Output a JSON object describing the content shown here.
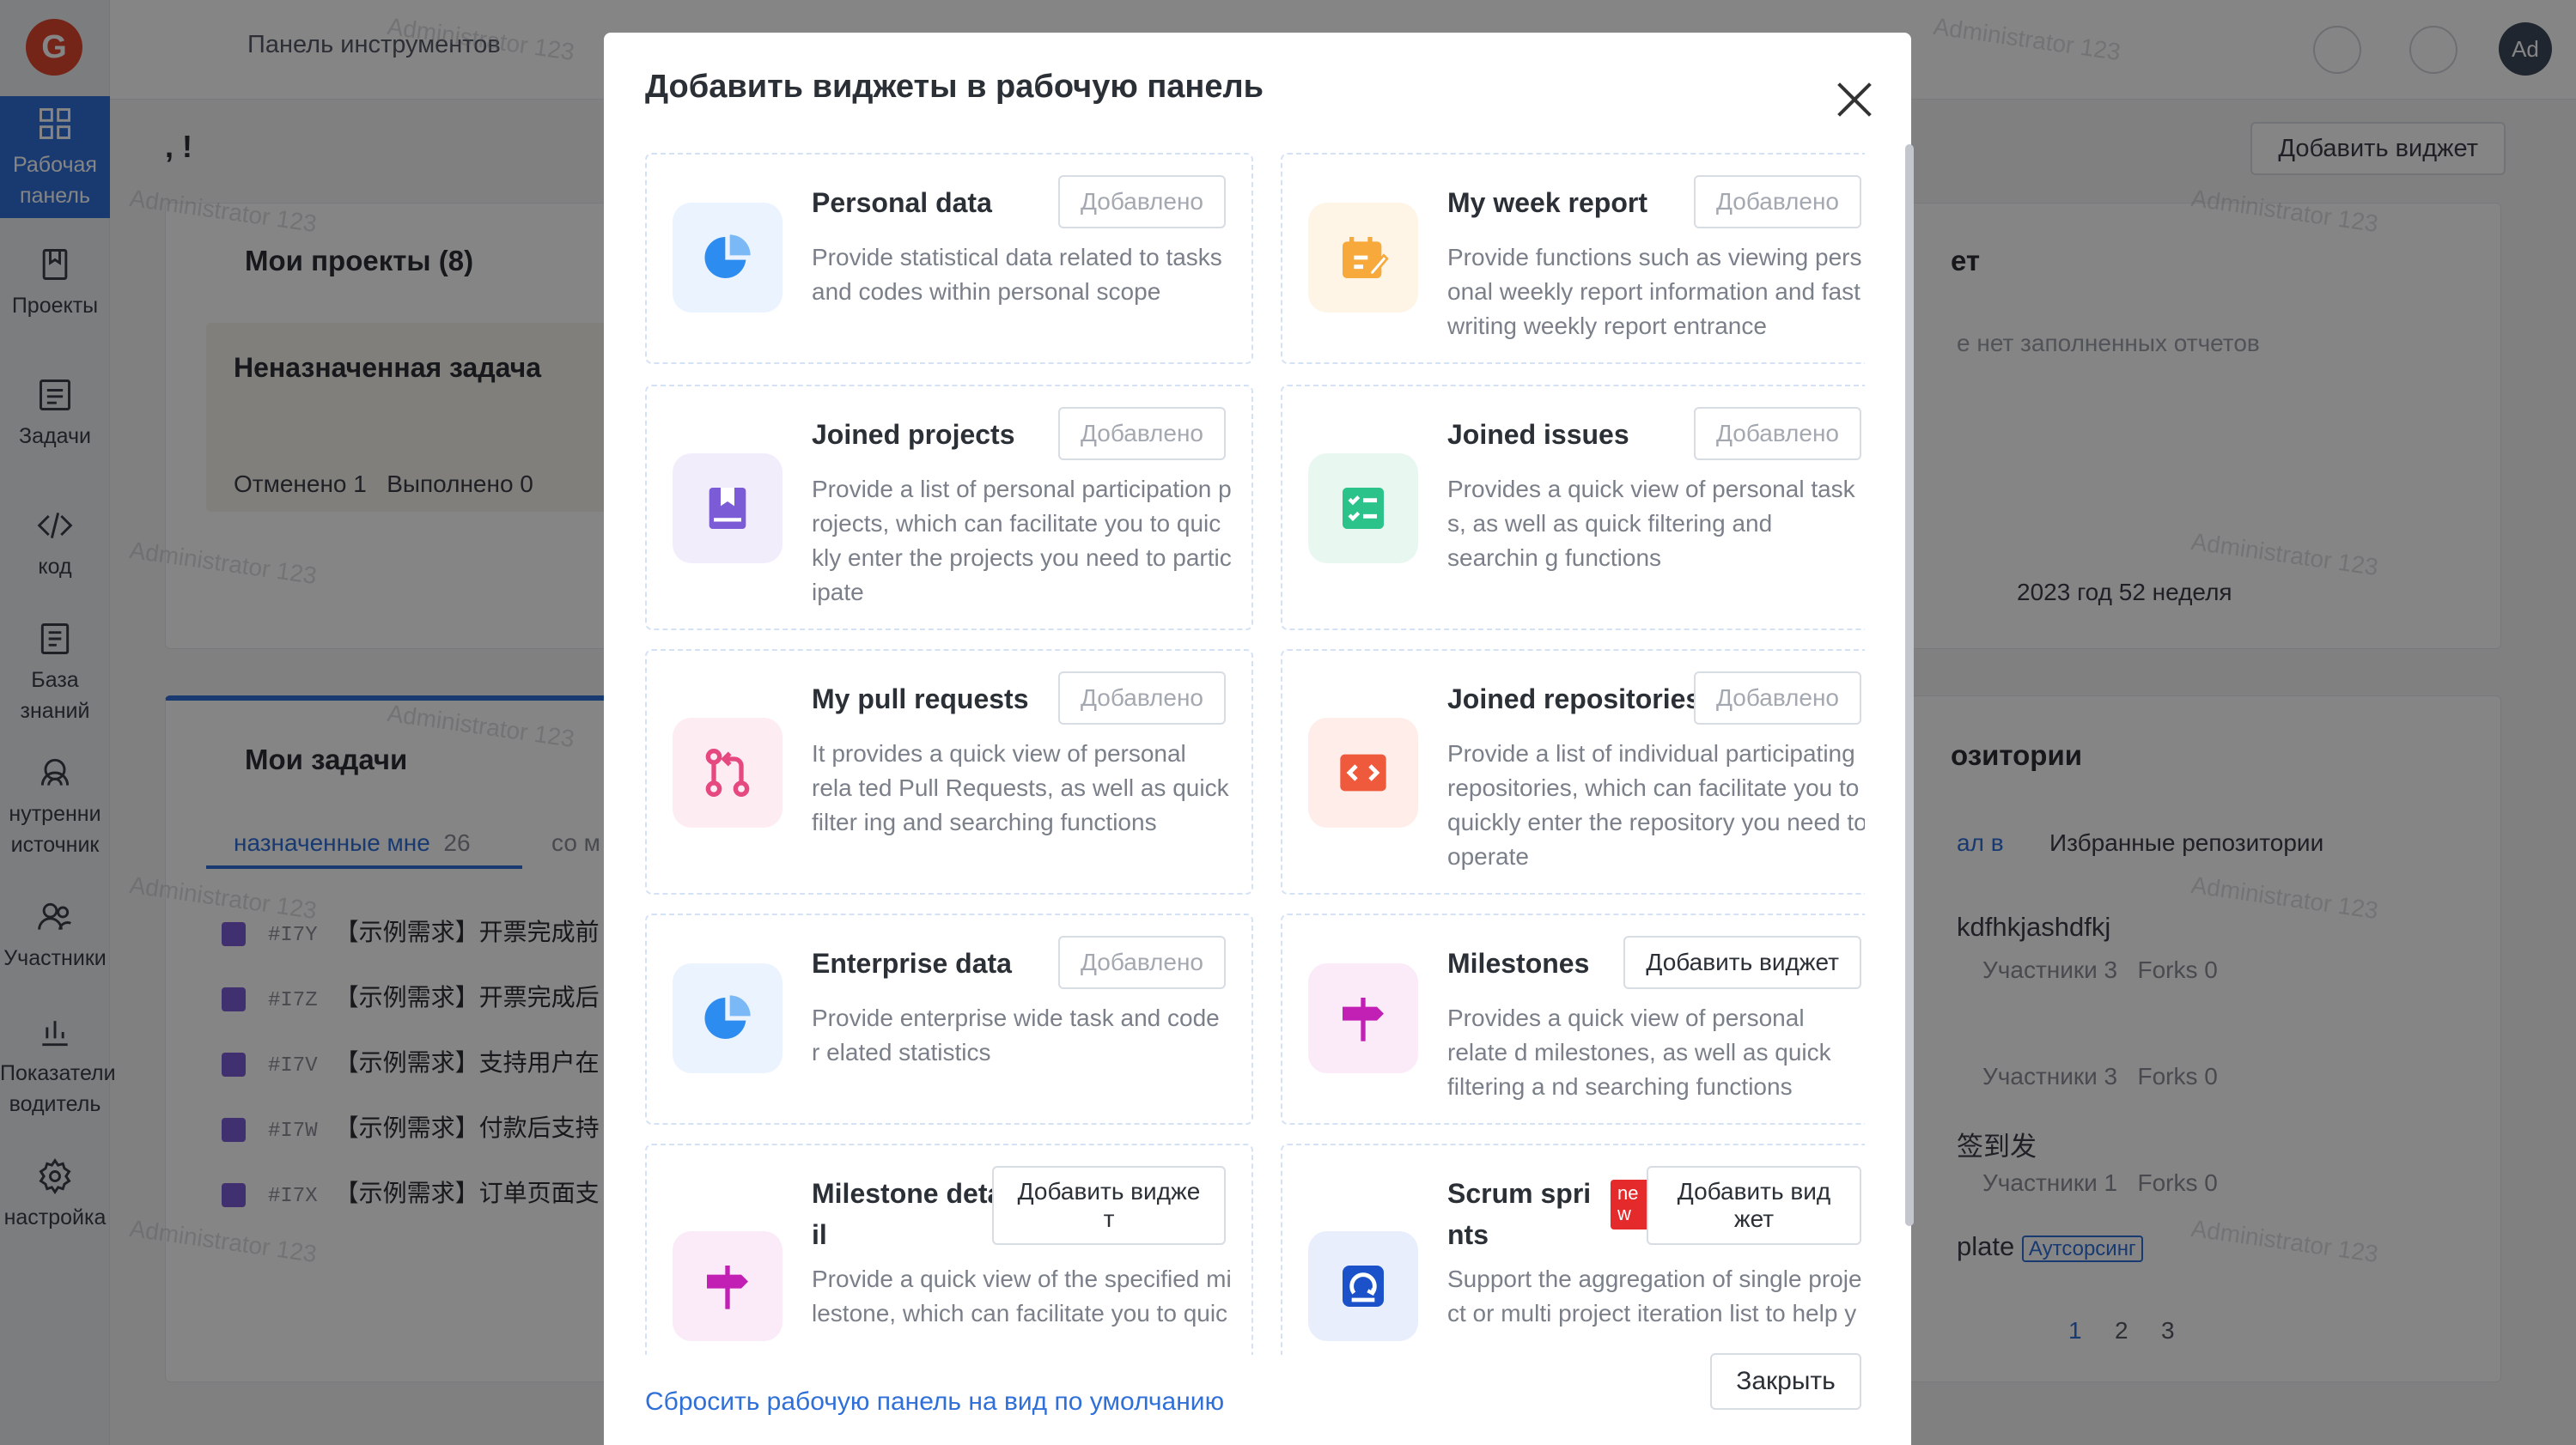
{
  "app": {
    "logo": "G",
    "breadcrumb": "Панель инструментов",
    "avatar": "Ad",
    "greeting": ", !",
    "add_widget_label": "Добавить виджет",
    "sidebar": [
      {
        "label": "Рабочая панель",
        "icon": "dashboard-icon",
        "active": true
      },
      {
        "label": "Проекты",
        "icon": "projects-icon"
      },
      {
        "label": "Задачи",
        "icon": "tasks-icon"
      },
      {
        "label": "код",
        "icon": "code-icon"
      },
      {
        "label": "База знаний",
        "icon": "knowledge-icon"
      },
      {
        "label": "нутренни источник",
        "icon": "source-icon"
      },
      {
        "label": "Участники",
        "icon": "members-icon"
      },
      {
        "label": "Показатели водитель",
        "icon": "metrics-icon"
      },
      {
        "label": "настройка",
        "icon": "settings-icon"
      }
    ],
    "projects_card": {
      "title": "Мои проекты (8)",
      "box_title": "Неназначенная задача",
      "canceled": "Отменено 1",
      "done": "Выполнено 0"
    },
    "tasks_card": {
      "title": "Мои задачи",
      "tab_assigned": "назначенные мне",
      "tab_assigned_count": "26",
      "tab_other": "со м",
      "rows": [
        {
          "id": "#I7Y",
          "text": "【示例需求】开票完成前"
        },
        {
          "id": "#I7Z",
          "text": "【示例需求】开票完成后"
        },
        {
          "id": "#I7V",
          "text": "【示例需求】支持用户在"
        },
        {
          "id": "#I7W",
          "text": "【示例需求】付款后支持"
        },
        {
          "id": "#I7X",
          "text": "【示例需求】订单页面支"
        }
      ]
    },
    "report_card": {
      "title": "ет",
      "empty": "е нет заполненных отчетов",
      "week": "2023 год 52 неделя"
    },
    "repo_card": {
      "title": "озитории",
      "tab1": "ал в",
      "tab2": "Избранные репозитории",
      "repos": [
        {
          "name": "kdfhkjashdfkj",
          "members": "Участники 3",
          "forks": "Forks 0"
        },
        {
          "name": "",
          "members": "Участники 3",
          "forks": "Forks 0"
        },
        {
          "name": "签到发",
          "members": "Участники 1",
          "forks": "Forks 0"
        },
        {
          "name": "plate",
          "badge": "Аутсорсинг"
        }
      ],
      "pages": [
        "1",
        "2",
        "3"
      ]
    },
    "watermark": "Administrator 123"
  },
  "modal": {
    "title": "Добавить виджеты в рабочую панель",
    "reset_link": "Сбросить рабочую панель на вид по умолчанию",
    "close_label": "Закрыть",
    "widgets": [
      {
        "name": "Personal data",
        "desc": "Provide statistical data related to tasks and codes within personal scope",
        "button": "Добавлено",
        "added": true,
        "icon": "pie-chart-icon",
        "color": "#2d8cf0",
        "bg": "#eaf3fe"
      },
      {
        "name": "My week report",
        "desc": "Provide functions such as viewing pers onal weekly report information and fast writing weekly report entrance",
        "button": "Добавлено",
        "added": true,
        "icon": "weekly-report-icon",
        "color": "#f7a93b",
        "bg": "#fef5e7"
      },
      {
        "name": "Joined projects",
        "desc": "Provide a list of personal participation p rojects, which can facilitate you to quic kly enter the projects you need to partic ipate",
        "button": "Добавлено",
        "added": true,
        "icon": "project-book-icon",
        "color": "#7b5cd6",
        "bg": "#f1edfb"
      },
      {
        "name": "Joined issues",
        "desc": "Provides a quick view of personal task s, as well as quick filtering and searchin g functions",
        "button": "Добавлено",
        "added": true,
        "icon": "checklist-icon",
        "color": "#2cc38a",
        "bg": "#e8f8f1"
      },
      {
        "name": "My pull requests",
        "desc": "It provides a quick view of personal rela ted Pull Requests, as well as quick filter ing and searching functions",
        "button": "Добавлено",
        "added": true,
        "icon": "pull-request-icon",
        "color": "#e64980",
        "bg": "#fdecf2"
      },
      {
        "name": "Joined repositories",
        "desc": "Provide a list of individual participating repositories, which can facilitate you to quickly enter the repository you need to operate",
        "button": "Добавлено",
        "added": true,
        "icon": "repository-code-icon",
        "color": "#f05a3c",
        "bg": "#feede9"
      },
      {
        "name": "Enterprise data",
        "desc": "Provide enterprise wide task and code r elated statistics",
        "button": "Добавлено",
        "added": true,
        "icon": "pie-chart-icon",
        "color": "#2d8cf0",
        "bg": "#eaf3fe"
      },
      {
        "name": "Milestones",
        "desc": "Provides a quick view of personal relate d milestones, as well as quick filtering a nd searching functions",
        "button": "Добавить виджет",
        "added": false,
        "icon": "signpost-icon",
        "color": "#c21fb4",
        "bg": "#fbeaf8"
      },
      {
        "name": "Milestone deta il",
        "desc": "Provide a quick view of the specified mi lestone, which can facilitate you to quic",
        "button": "Добавить видже т",
        "added": false,
        "icon": "signpost-icon",
        "color": "#c21fb4",
        "bg": "#fbeaf8"
      },
      {
        "name": "Scrum spri nts",
        "desc": "Support the aggregation of single proje ct or multi project iteration list to help y",
        "button": "Добавить вид жет",
        "added": false,
        "new_tag": "ne w",
        "icon": "sprint-cycle-icon",
        "color": "#1c52c9",
        "bg": "#e8eefb"
      }
    ]
  }
}
